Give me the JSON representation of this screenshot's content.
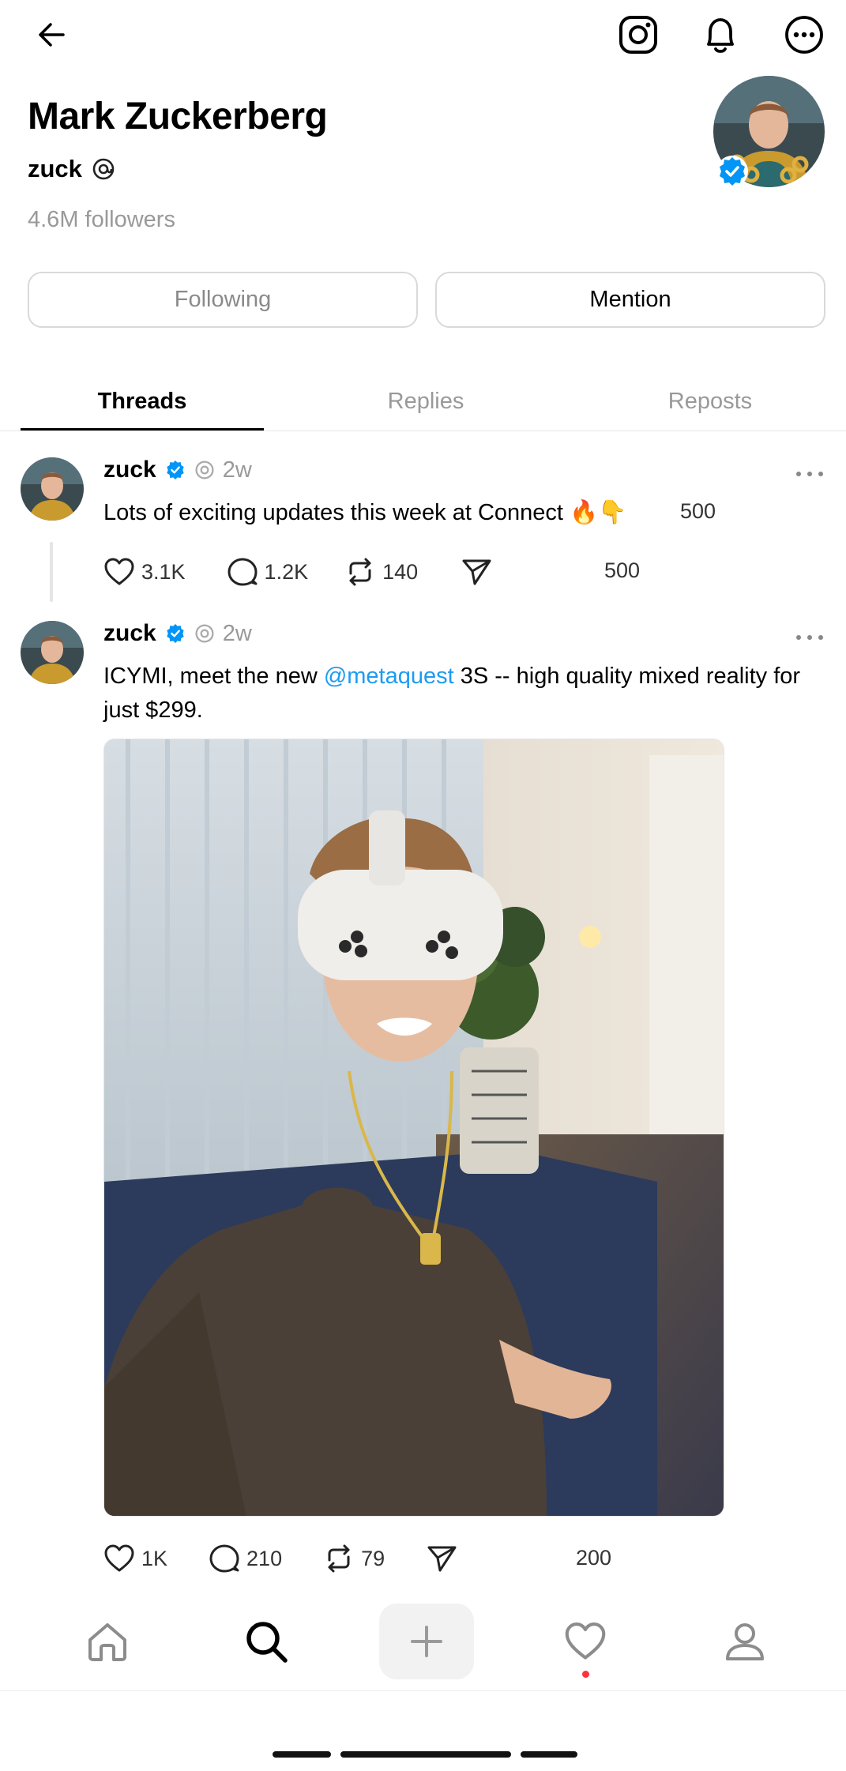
{
  "profile": {
    "name": "Mark Zuckerberg",
    "handle": "zuck",
    "followers": "4.6M followers",
    "following_label": "Following",
    "mention_label": "Mention"
  },
  "tabs": [
    {
      "label": "Threads",
      "active": true
    },
    {
      "label": "Replies",
      "active": false
    },
    {
      "label": "Reposts",
      "active": false
    }
  ],
  "posts": [
    {
      "author": "zuck",
      "time": "2w",
      "text": "Lots of exciting updates this week at Connect 🔥👇",
      "likes": "3.1K",
      "comments": "1.2K",
      "reposts": "140",
      "overlay_num_top": "500",
      "overlay_num_bottom": "500"
    },
    {
      "author": "zuck",
      "time": "2w",
      "text_before": "ICYMI, meet the new ",
      "mention": "@metaquest",
      "text_after_line1": " 3S -- high quality mixed reality for",
      "text_line2": "just $299.",
      "likes": "1K",
      "comments": "210",
      "reposts": "79",
      "overlay_num": "200"
    }
  ],
  "colors": {
    "accent_blue": "#1d9bf0",
    "verified_blue": "#0095f6",
    "muted_gray": "#999999",
    "notification_red": "#ff3040"
  },
  "icons": {
    "top": [
      "back-arrow-icon",
      "instagram-icon",
      "bell-icon",
      "more-options-icon"
    ],
    "nav": [
      "home-icon",
      "search-icon",
      "plus-icon",
      "heart-icon",
      "profile-icon"
    ]
  }
}
